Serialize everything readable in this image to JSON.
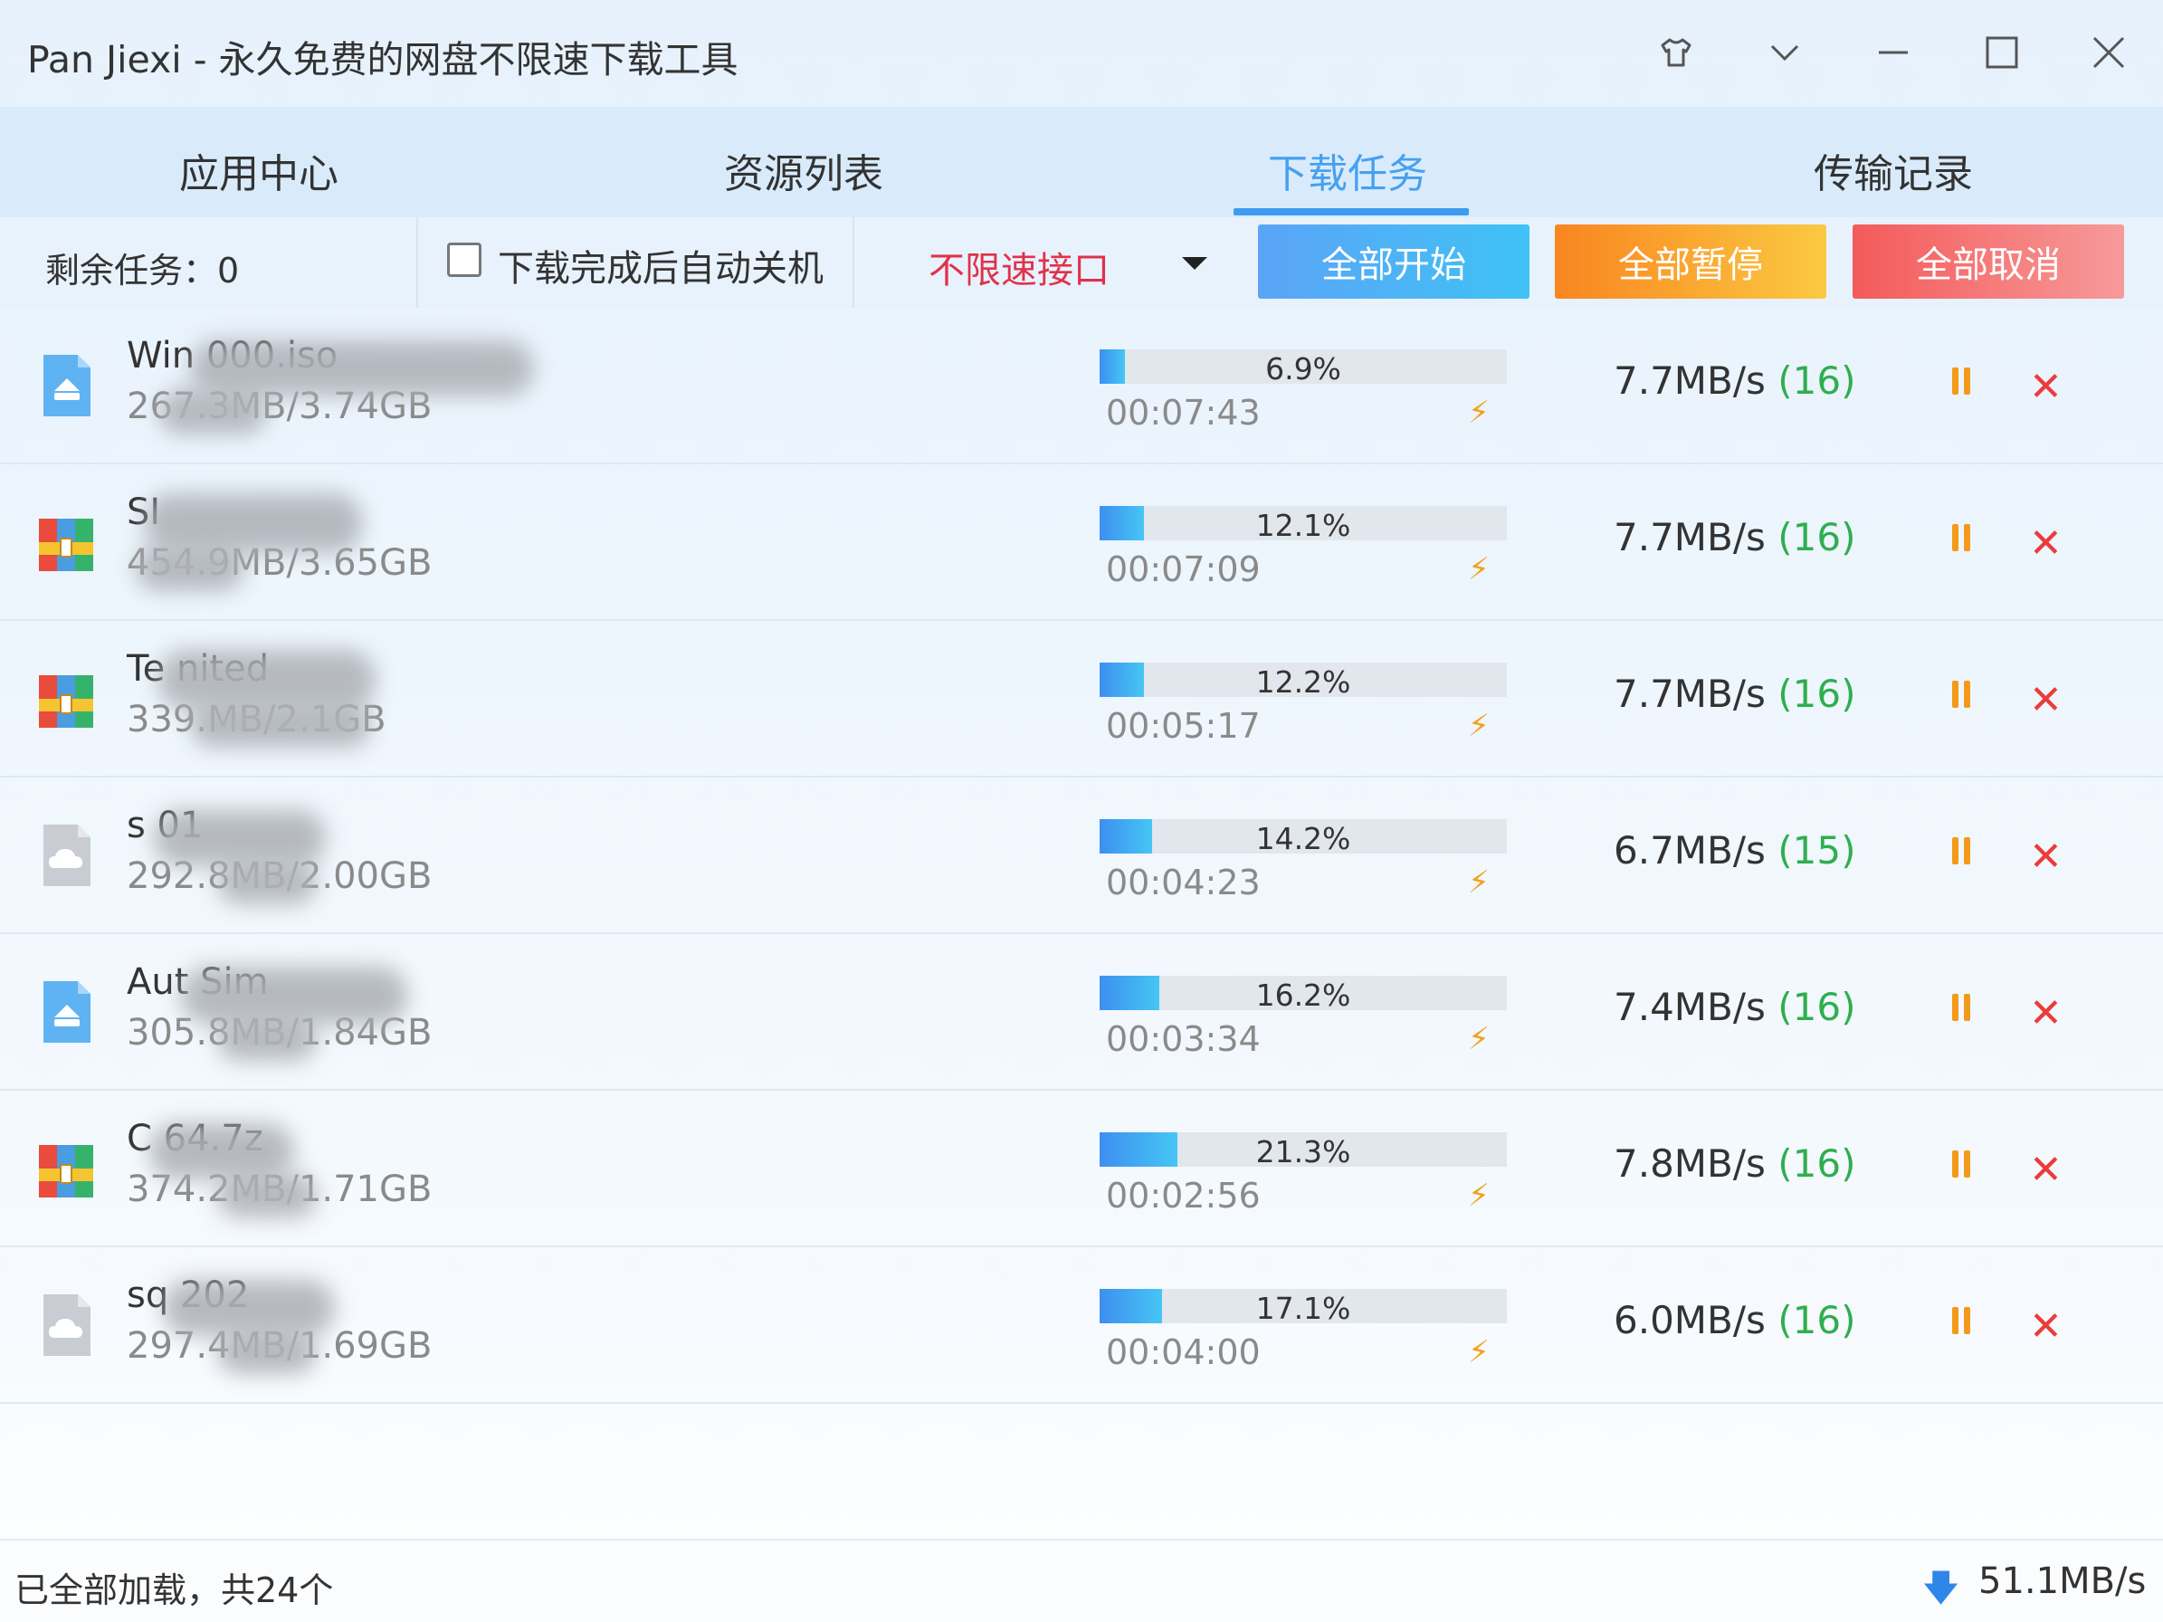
{
  "window": {
    "title": "Pan Jiexi - 永久免费的网盘不限速下载工具"
  },
  "tabs": [
    {
      "label": "应用中心",
      "active": false
    },
    {
      "label": "资源列表",
      "active": false
    },
    {
      "label": "下载任务",
      "active": true
    },
    {
      "label": "传输记录",
      "active": false
    }
  ],
  "toolbar": {
    "remaining_label": "剩余任务：0",
    "shutdown_label": "下载完成后自动关机",
    "shutdown_checked": false,
    "interface_value": "不限速接口",
    "start_all_label": "全部开始",
    "pause_all_label": "全部暂停",
    "cancel_all_label": "全部取消"
  },
  "tasks": [
    {
      "icon": "disc-image-icon",
      "name": "Win 000.iso",
      "size": "267.3MB/3.74GB",
      "progress": 6.9,
      "progress_label": "6.9%",
      "eta": "00:07:43",
      "speed": "7.7MB/s",
      "threads": "(16)"
    },
    {
      "icon": "archive-icon",
      "name": "SI",
      "size": "454.9MB/3.65GB",
      "progress": 12.1,
      "progress_label": "12.1%",
      "eta": "00:07:09",
      "speed": "7.7MB/s",
      "threads": "(16)"
    },
    {
      "icon": "archive-icon",
      "name": "Te nited",
      "size": "339.MB/2.1GB",
      "progress": 12.2,
      "progress_label": "12.2%",
      "eta": "00:05:17",
      "speed": "7.7MB/s",
      "threads": "(16)"
    },
    {
      "icon": "cloud-file-icon",
      "name": "s 01",
      "size": "292.8MB/2.00GB",
      "progress": 14.2,
      "progress_label": "14.2%",
      "eta": "00:04:23",
      "speed": "6.7MB/s",
      "threads": "(15)"
    },
    {
      "icon": "disc-image-icon",
      "name": "Aut Sim",
      "size": "305.8MB/1.84GB",
      "progress": 16.2,
      "progress_label": "16.2%",
      "eta": "00:03:34",
      "speed": "7.4MB/s",
      "threads": "(16)"
    },
    {
      "icon": "archive-icon",
      "name": "C 64.7z",
      "size": "374.2MB/1.71GB",
      "progress": 21.3,
      "progress_label": "21.3%",
      "eta": "00:02:56",
      "speed": "7.8MB/s",
      "threads": "(16)"
    },
    {
      "icon": "cloud-file-icon",
      "name": "sq 202",
      "size": "297.4MB/1.69GB",
      "progress": 17.1,
      "progress_label": "17.1%",
      "eta": "00:04:00",
      "speed": "6.0MB/s",
      "threads": "(16)"
    }
  ],
  "status": {
    "left_text": "已全部加载，共24个",
    "total_speed": "51.1MB/s"
  }
}
